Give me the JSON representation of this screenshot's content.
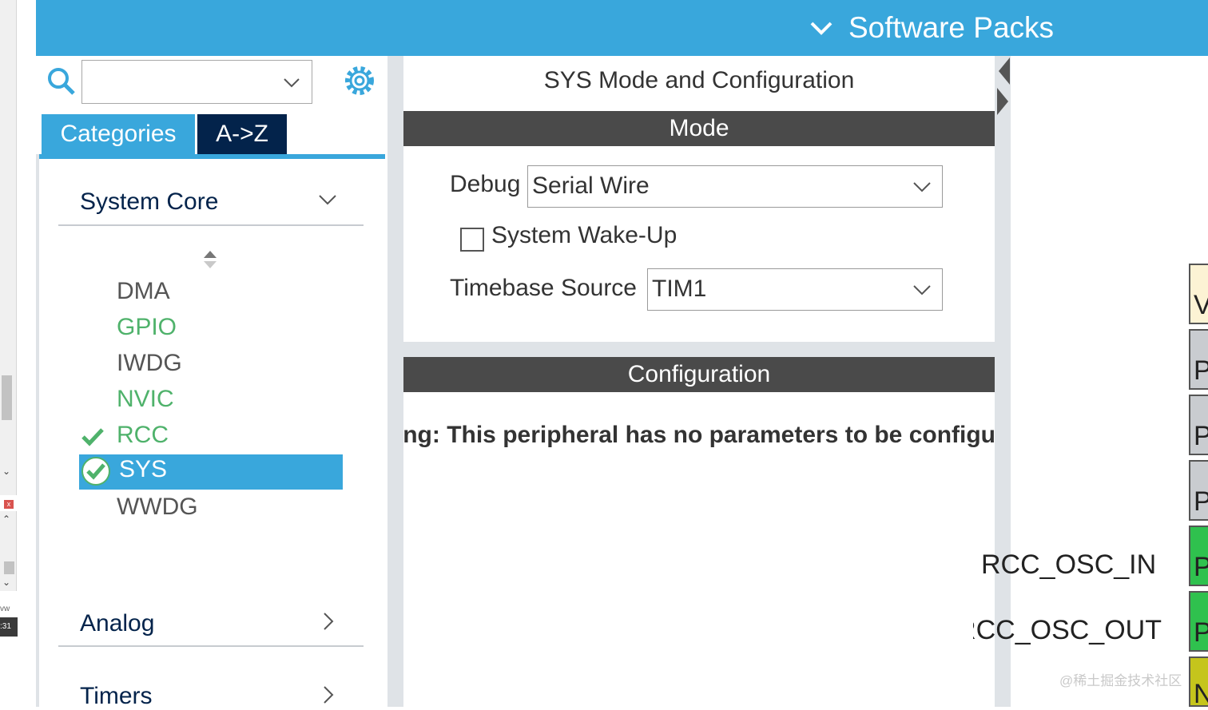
{
  "header": {
    "software_packs": "Software Packs"
  },
  "left_panel": {
    "search": {
      "value": ""
    },
    "tabs": [
      {
        "label": "Categories"
      },
      {
        "label": "A->Z"
      }
    ],
    "categories": [
      {
        "label": "System Core",
        "expanded": true
      },
      {
        "label": "Analog",
        "expanded": false
      },
      {
        "label": "Timers",
        "expanded": false
      }
    ],
    "system_core_items": [
      {
        "label": "DMA",
        "status": "default"
      },
      {
        "label": "GPIO",
        "status": "green"
      },
      {
        "label": "IWDG",
        "status": "default"
      },
      {
        "label": "NVIC",
        "status": "green"
      },
      {
        "label": "RCC",
        "status": "checked"
      },
      {
        "label": "SYS",
        "status": "selected"
      },
      {
        "label": "WWDG",
        "status": "default"
      }
    ]
  },
  "center": {
    "title": "SYS Mode and Configuration",
    "mode_header": "Mode",
    "debug_label": "Debug",
    "debug_value": "Serial Wire",
    "wakeup_label": "System Wake-Up",
    "wakeup_checked": false,
    "timebase_label": "Timebase Source",
    "timebase_value": "TIM1",
    "config_header": "Configuration",
    "warning": "Warning: This peripheral has no parameters to be configured."
  },
  "right": {
    "pin_labels": [
      "RCC_OSC_IN",
      "RCC_OSC_OUT"
    ],
    "pins": [
      {
        "text": "V",
        "color": "#fcf3d4"
      },
      {
        "text": "P",
        "color": "#c9ccd0"
      },
      {
        "text": "P",
        "color": "#c9ccd0"
      },
      {
        "text": "P",
        "color": "#c9ccd0"
      },
      {
        "text": "P",
        "color": "#2fc14e"
      },
      {
        "text": "P",
        "color": "#2fc14e"
      },
      {
        "text": "N",
        "color": "#c5c51c"
      }
    ],
    "watermark": "@稀土掘金技术社区"
  },
  "left_edge": {
    "text_ww": "vw",
    "text_31": ":31"
  },
  "colors": {
    "accent": "#39a7dc",
    "dark_tab": "#03234b",
    "header_bar": "#4a4a4a",
    "ok_green": "#4fb26b"
  }
}
